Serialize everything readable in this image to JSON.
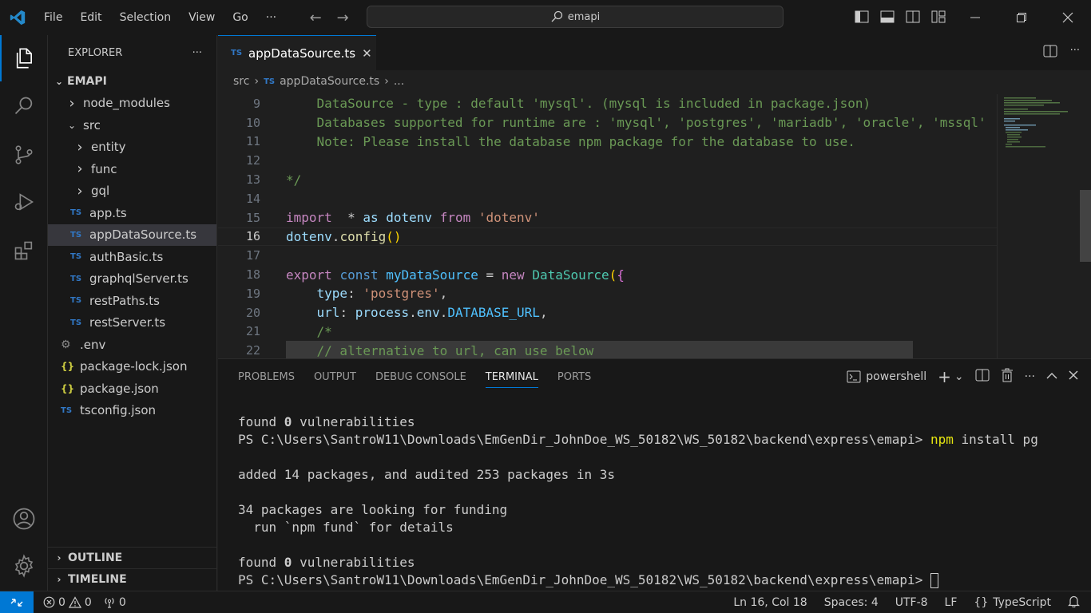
{
  "menu": [
    "File",
    "Edit",
    "Selection",
    "View",
    "Go",
    "···"
  ],
  "search": {
    "text": "emapi"
  },
  "sidebar": {
    "title": "EXPLORER",
    "root": "EMAPI",
    "items": [
      {
        "label": "node_modules",
        "kind": "folder",
        "depth": 1,
        "open": false
      },
      {
        "label": "src",
        "kind": "folder",
        "depth": 1,
        "open": true
      },
      {
        "label": "entity",
        "kind": "folder",
        "depth": 2,
        "open": false
      },
      {
        "label": "func",
        "kind": "folder",
        "depth": 2,
        "open": false
      },
      {
        "label": "gql",
        "kind": "folder",
        "depth": 2,
        "open": false
      },
      {
        "label": "app.ts",
        "kind": "ts",
        "depth": 2
      },
      {
        "label": "appDataSource.ts",
        "kind": "ts",
        "depth": 2,
        "selected": true
      },
      {
        "label": "authBasic.ts",
        "kind": "ts",
        "depth": 2
      },
      {
        "label": "graphqlServer.ts",
        "kind": "ts",
        "depth": 2
      },
      {
        "label": "restPaths.ts",
        "kind": "ts",
        "depth": 2
      },
      {
        "label": "restServer.ts",
        "kind": "ts",
        "depth": 2
      },
      {
        "label": ".env",
        "kind": "env",
        "depth": 1
      },
      {
        "label": "package-lock.json",
        "kind": "json",
        "depth": 1
      },
      {
        "label": "package.json",
        "kind": "json",
        "depth": 1
      },
      {
        "label": "tsconfig.json",
        "kind": "ts",
        "depth": 1
      }
    ],
    "outline": "OUTLINE",
    "timeline": "TIMELINE"
  },
  "editor": {
    "tab": {
      "icon": "TS",
      "label": "appDataSource.ts"
    },
    "breadcrumb": [
      "src",
      "TS",
      "appDataSource.ts",
      "..."
    ],
    "lines": [
      {
        "n": "9",
        "text": "    DataSource - type : default 'mysql'. (mysql is included in package.json)"
      },
      {
        "n": "10",
        "text": "    Databases supported for runtime are : 'mysql', 'postgres', 'mariadb', 'oracle', 'mssql'"
      },
      {
        "n": "11",
        "text": "    Note: Please install the database npm package for the database to use."
      },
      {
        "n": "12",
        "text": ""
      },
      {
        "n": "13",
        "text": "*/"
      },
      {
        "n": "14",
        "text": ""
      },
      {
        "n": "15",
        "text": "import  * as dotenv from 'dotenv'"
      },
      {
        "n": "16",
        "text": "dotenv.config()"
      },
      {
        "n": "17",
        "text": ""
      },
      {
        "n": "18",
        "text": "export const myDataSource = new DataSource({"
      },
      {
        "n": "19",
        "text": "    type: 'postgres',"
      },
      {
        "n": "20",
        "text": "    url: process.env.DATABASE_URL,"
      },
      {
        "n": "21",
        "text": "    /*"
      },
      {
        "n": "22",
        "text": "    // alternative to url, can use below"
      }
    ]
  },
  "panel": {
    "tabs": [
      "PROBLEMS",
      "OUTPUT",
      "DEBUG CONSOLE",
      "TERMINAL",
      "PORTS"
    ],
    "active": "TERMINAL",
    "shell": "powershell",
    "terminal": {
      "found1_pre": "found ",
      "found1_num": "0",
      "found1_post": " vulnerabilities",
      "prompt1": "PS C:\\Users\\SantroW11\\Downloads\\EmGenDir_JohnDoe_WS_50182\\WS_50182\\backend\\express\\emapi> ",
      "cmd_npm": "npm",
      "cmd_rest": " install pg",
      "added": "added 14 packages, and audited 253 packages in 3s",
      "funding1": "34 packages are looking for funding",
      "funding2": "  run `npm fund` for details",
      "found2_pre": "found ",
      "found2_num": "0",
      "found2_post": " vulnerabilities",
      "prompt2": "PS C:\\Users\\SantroW11\\Downloads\\EmGenDir_JohnDoe_WS_50182\\WS_50182\\backend\\express\\emapi> "
    }
  },
  "status": {
    "errors": "0",
    "warnings": "0",
    "ports": "0",
    "position": "Ln 16, Col 18",
    "spaces": "Spaces: 4",
    "encoding": "UTF-8",
    "eol": "LF",
    "language": "TypeScript",
    "language_icon": "{}"
  },
  "colors": {
    "accent": "#0078d4"
  }
}
